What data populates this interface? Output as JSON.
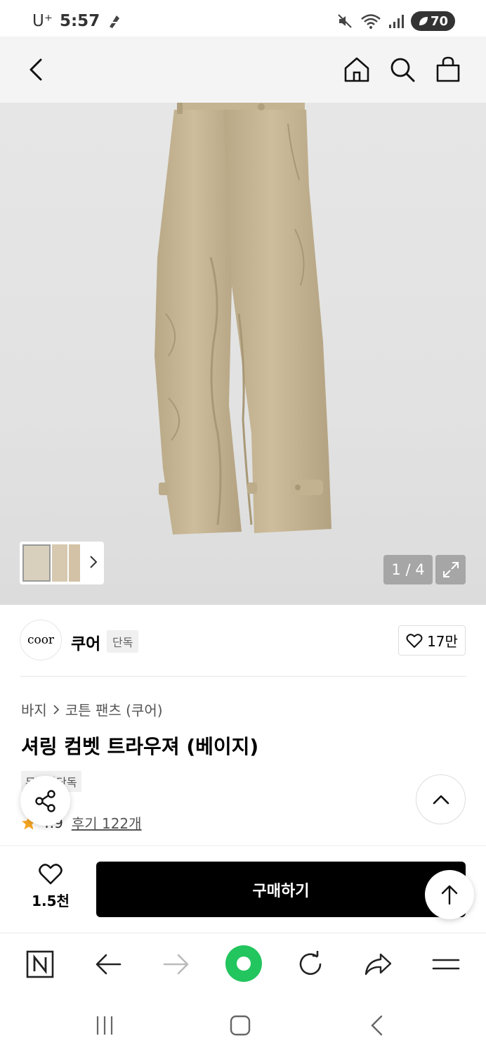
{
  "status_bar": {
    "carrier": "U⁺",
    "time": "5:57",
    "battery": "70"
  },
  "top_nav": {
    "back_icon": "chevron-left-icon",
    "home_icon": "home-icon",
    "search_icon": "search-icon",
    "bag_icon": "shopping-bag-icon"
  },
  "gallery": {
    "counter": "1 / 4",
    "product_color": "#c8b898"
  },
  "brand": {
    "logo_text": "coor",
    "name": "쿠어",
    "badge": "단독",
    "likes": "17만"
  },
  "product": {
    "breadcrumb": [
      "바지",
      "코튼 팬츠 (쿠어)"
    ],
    "title": "셔링 컴벳 트라우져 (베이지)",
    "tag": "무신사단독",
    "rating": "4.9",
    "reviews": "후기 122개"
  },
  "buy_bar": {
    "wish_count": "1.5천",
    "buy_label": "구매하기"
  },
  "colors": {
    "accent_star": "#f5a623",
    "browser_green": "#22c55e",
    "buy_button": "#000000"
  }
}
